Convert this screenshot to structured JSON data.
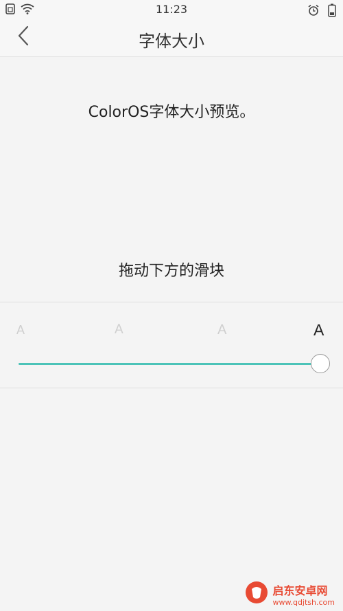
{
  "status_bar": {
    "time": "11:23"
  },
  "header": {
    "title": "字体大小",
    "back_icon": "chevron-left-icon"
  },
  "preview": {
    "text": "ColorOS字体大小预览。"
  },
  "hint": {
    "text": "拖动下方的滑块"
  },
  "font_size": {
    "labels": [
      "A",
      "A",
      "A",
      "A"
    ],
    "selected_index": 3,
    "level_fraction": 1.0
  },
  "watermark": {
    "name": "启东安卓网",
    "url": "www.qdjtsh.com"
  },
  "colors": {
    "accent": "#4cc3b8",
    "background": "#f4f4f4",
    "watermark": "#e84a33"
  }
}
